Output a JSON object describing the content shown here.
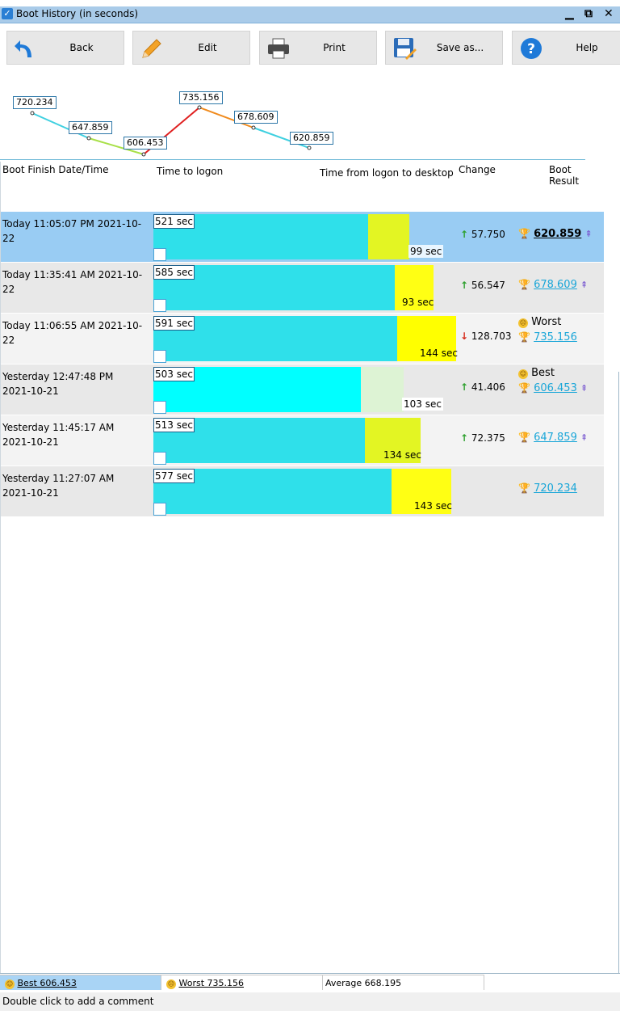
{
  "window": {
    "title": "Boot History (in seconds)"
  },
  "toolbar": {
    "back": "Back",
    "edit": "Edit",
    "print": "Print",
    "save": "Save as...",
    "help": "Help"
  },
  "sparkline": {
    "points": [
      "720.234",
      "647.859",
      "606.453",
      "735.156",
      "678.609",
      "620.859"
    ]
  },
  "columns": {
    "date": "Boot Finish Date/Time",
    "logon": "Time to logon",
    "desktop": "Time from logon to desktop",
    "change": "Change",
    "result": "Boot Result"
  },
  "rows": [
    {
      "date1": "Today  11:05:07 PM 2021-10-22",
      "date2": "",
      "logon": "521 sec",
      "logon_value": 521,
      "desktop": "99 sec",
      "desktop_value": 99,
      "change": "57.750",
      "change_dir": "up",
      "badge": "",
      "result": "620.859"
    },
    {
      "date1": "Today  11:35:41 AM 2021-10-22",
      "date2": "",
      "logon": "585 sec",
      "logon_value": 585,
      "desktop": "93 sec",
      "desktop_value": 93,
      "change": "56.547",
      "change_dir": "up",
      "badge": "",
      "result": "678.609"
    },
    {
      "date1": "Today  11:06:55 AM 2021-10-22",
      "date2": "",
      "logon": "591 sec",
      "logon_value": 591,
      "desktop": "144 sec",
      "desktop_value": 144,
      "change": "128.703",
      "change_dir": "down",
      "badge": "Worst",
      "result": "735.156"
    },
    {
      "date1": "Yesterday  12:47:48 PM",
      "date2": "2021-10-21",
      "logon": "503 sec",
      "logon_value": 503,
      "desktop": "103 sec",
      "desktop_value": 103,
      "change": "41.406",
      "change_dir": "up",
      "badge": "Best",
      "result": "606.453"
    },
    {
      "date1": "Yesterday  11:45:17 AM",
      "date2": "2021-10-21",
      "logon": "513 sec",
      "logon_value": 513,
      "desktop": "134 sec",
      "desktop_value": 134,
      "change": "72.375",
      "change_dir": "up",
      "badge": "",
      "result": "647.859"
    },
    {
      "date1": "Yesterday  11:27:07 AM",
      "date2": "2021-10-21",
      "logon": "577 sec",
      "logon_value": 577,
      "desktop": "143 sec",
      "desktop_value": 143,
      "change": "",
      "change_dir": "",
      "badge": "",
      "result": "720.234"
    }
  ],
  "status": {
    "best": "Best 606.453",
    "worst": "Worst 735.156",
    "average": "Average 668.195"
  },
  "hint": "Double click to add a comment",
  "colors": {
    "selected_row": "#99ccf3",
    "row_alt": "#e8e8e8",
    "row_light": "#f3f3f3",
    "logon_bar": "#2fe0ea",
    "logon_best": "#00ffff",
    "desktop_bar": "#ffff00",
    "desktop_best": "#ddf3d4",
    "link": "#1aa6d8"
  }
}
